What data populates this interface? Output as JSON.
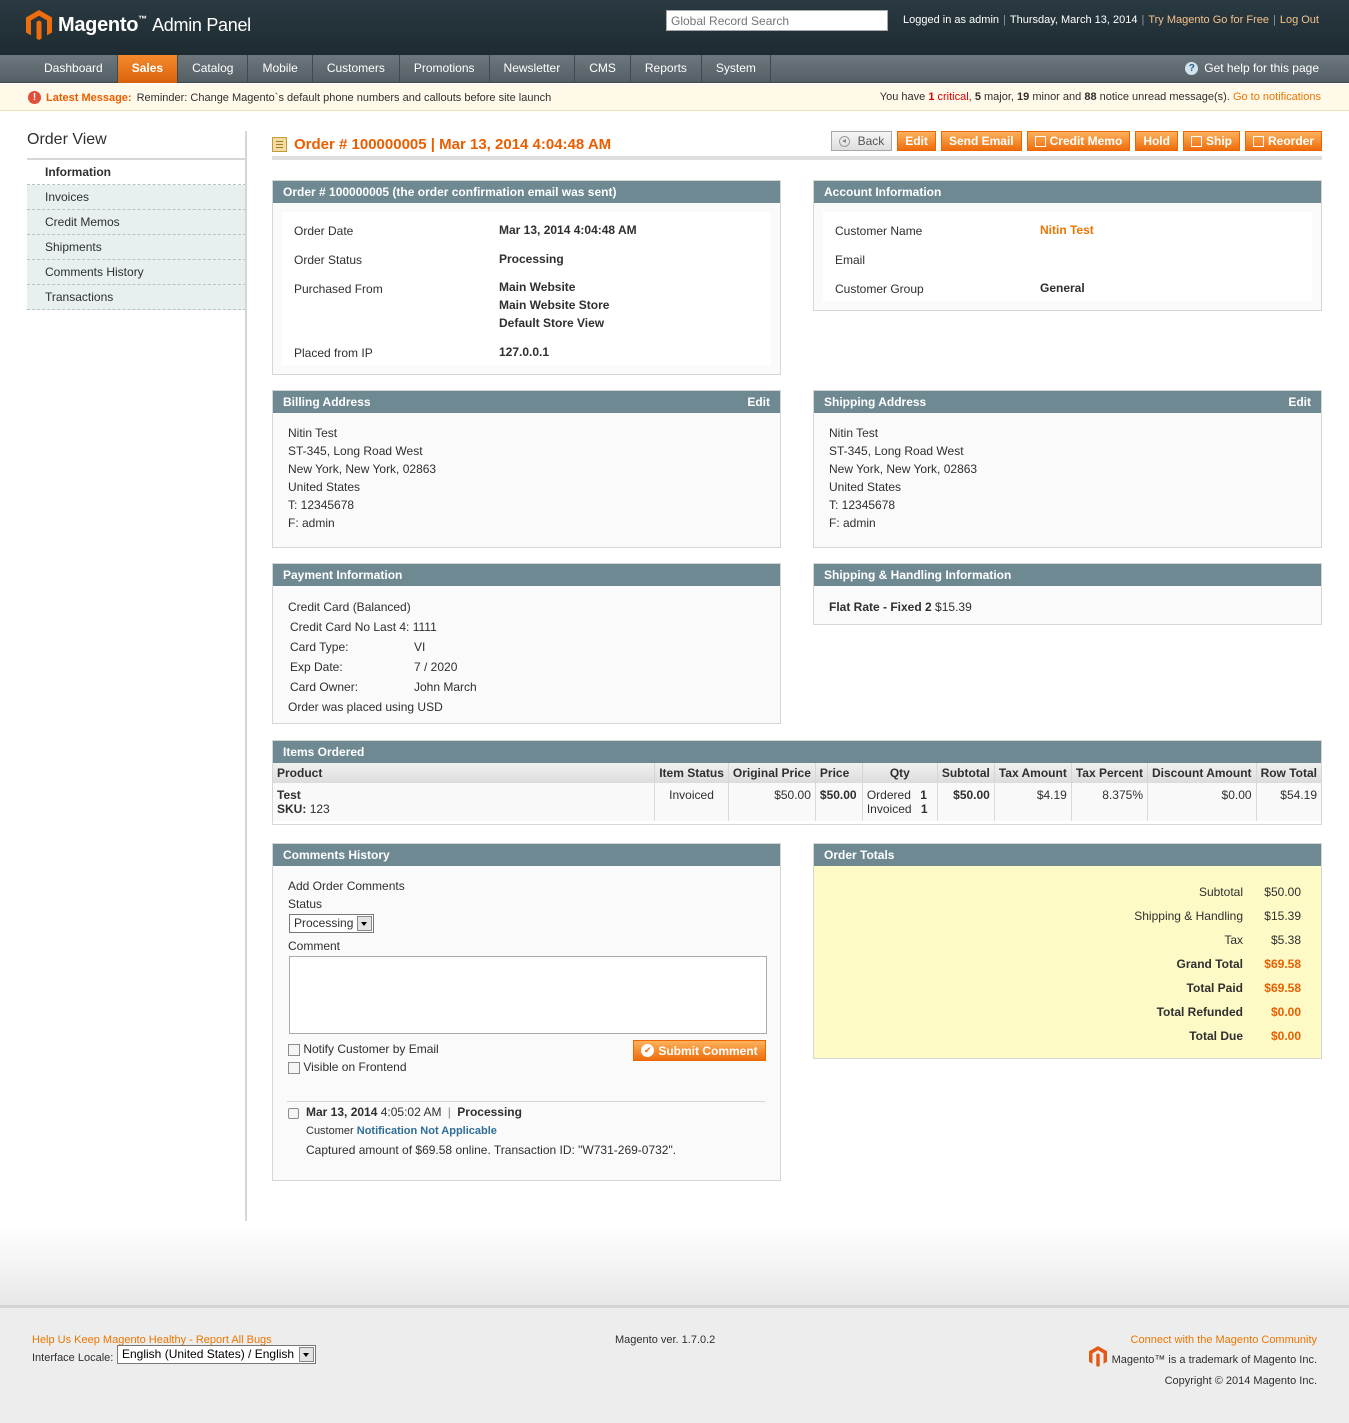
{
  "header": {
    "logo_text": "Magento",
    "logo_tm": "™",
    "logo_suffix": "Admin Panel",
    "search_placeholder": "Global Record Search",
    "logged_in": "Logged in as admin",
    "date": "Thursday, March 13, 2014",
    "try_link": "Try Magento Go for Free",
    "logout": "Log Out"
  },
  "nav": {
    "items": [
      "Dashboard",
      "Sales",
      "Catalog",
      "Mobile",
      "Customers",
      "Promotions",
      "Newsletter",
      "CMS",
      "Reports",
      "System"
    ],
    "active": "Sales",
    "help": "Get help for this page"
  },
  "message": {
    "label": "Latest Message:",
    "text": "Reminder: Change Magento`s default phone numbers and callouts before site launch",
    "summary_pre": "You have",
    "critical_count": "1",
    "critical": "critical,",
    "major_count": "5",
    "major": "major,",
    "minor_count": "19",
    "minor": "minor and",
    "notice_count": "88",
    "notice": "notice unread message(s).",
    "link": "Go to notifications"
  },
  "sidebar": {
    "title": "Order View",
    "items": [
      "Information",
      "Invoices",
      "Credit Memos",
      "Shipments",
      "Comments History",
      "Transactions"
    ]
  },
  "page": {
    "title": "Order # 100000005 | Mar 13, 2014 4:04:48 AM",
    "buttons": [
      "Back",
      "Edit",
      "Send Email",
      "Credit Memo",
      "Hold",
      "Ship",
      "Reorder"
    ]
  },
  "order_info": {
    "header": "Order # 100000005 (the order confirmation email was sent)",
    "order_date_label": "Order Date",
    "order_date": "Mar 13, 2014 4:04:48 AM",
    "status_label": "Order Status",
    "status": "Processing",
    "purchased_label": "Purchased From",
    "purchased": [
      "Main Website",
      "Main Website Store",
      "Default Store View"
    ],
    "ip_label": "Placed from IP",
    "ip": "127.0.0.1"
  },
  "account": {
    "header": "Account Information",
    "name_label": "Customer Name",
    "name": "Nitin Test",
    "email_label": "Email",
    "group_label": "Customer Group",
    "group": "General"
  },
  "billing": {
    "header": "Billing Address",
    "edit": "Edit",
    "lines": [
      "Nitin Test",
      "ST-345, Long Road West",
      "New York, New York, 02863",
      "United States",
      "T: 12345678",
      "F: admin"
    ]
  },
  "shipping": {
    "header": "Shipping Address",
    "edit": "Edit",
    "lines": [
      "Nitin Test",
      "ST-345, Long Road West",
      "New York, New York, 02863",
      "United States",
      "T: 12345678",
      "F: admin"
    ]
  },
  "payment": {
    "header": "Payment Information",
    "method": "Credit Card (Balanced)",
    "cc_last4_label": "Credit Card No Last 4:",
    "cc_last4": "1111",
    "type_label": "Card Type:",
    "type": "VI",
    "exp_label": "Exp Date:",
    "exp": "7 / 2020",
    "owner_label": "Card Owner:",
    "owner": "John March",
    "currency_note": "Order was placed using USD"
  },
  "shipping_method": {
    "header": "Shipping & Handling Information",
    "method": "Flat Rate - Fixed 2",
    "price": "$15.39"
  },
  "items": {
    "header": "Items Ordered",
    "columns": [
      "Product",
      "Item Status",
      "Original Price",
      "Price",
      "Qty",
      "Subtotal",
      "Tax Amount",
      "Tax Percent",
      "Discount Amount",
      "Row Total"
    ],
    "row": {
      "name": "Test",
      "sku_label": "SKU:",
      "sku": "123",
      "status": "Invoiced",
      "original_price": "$50.00",
      "price": "$50.00",
      "qty_ordered_label": "Ordered",
      "qty_ordered": "1",
      "qty_invoiced_label": "Invoiced",
      "qty_invoiced": "1",
      "subtotal": "$50.00",
      "tax_amount": "$4.19",
      "tax_percent": "8.375%",
      "discount": "$0.00",
      "row_total": "$54.19"
    }
  },
  "comments": {
    "header": "Comments History",
    "add_label": "Add Order Comments",
    "status_label": "Status",
    "status_value": "Processing",
    "comment_label": "Comment",
    "notify_label": "Notify Customer by Email",
    "visible_label": "Visible on Frontend",
    "submit": "Submit Comment",
    "entry_date": "Mar 13, 2014",
    "entry_time": "4:05:02 AM",
    "entry_status": "Processing",
    "entry_customer": "Customer",
    "entry_notify": "Notification Not Applicable",
    "entry_text": "Captured amount of $69.58 online. Transaction ID: \"W731-269-0732\"."
  },
  "totals": {
    "header": "Order Totals",
    "rows": [
      {
        "label": "Subtotal",
        "value": "$50.00"
      },
      {
        "label": "Shipping & Handling",
        "value": "$15.39"
      },
      {
        "label": "Tax",
        "value": "$5.38"
      },
      {
        "label": "Grand Total",
        "value": "$69.58"
      },
      {
        "label": "Total Paid",
        "value": "$69.58"
      },
      {
        "label": "Total Refunded",
        "value": "$0.00"
      },
      {
        "label": "Total Due",
        "value": "$0.00"
      }
    ]
  },
  "footer": {
    "bugs_link": "Help Us Keep Magento Healthy - Report All Bugs",
    "locale_label": "Interface Locale:",
    "locale_value": "English (United States) / English",
    "version": "Magento ver. 1.7.0.2",
    "community_link": "Connect with the Magento Community",
    "trademark": "Magento™ is a trademark of Magento Inc.",
    "copyright": "Copyright © 2014 Magento Inc."
  },
  "colors": {
    "brand_orange": "#eb5e00",
    "box_header": "#6f8992",
    "nav_bg": "#5f6a70",
    "header_bg": "#23323a",
    "totals_bg": "#fefac6"
  }
}
